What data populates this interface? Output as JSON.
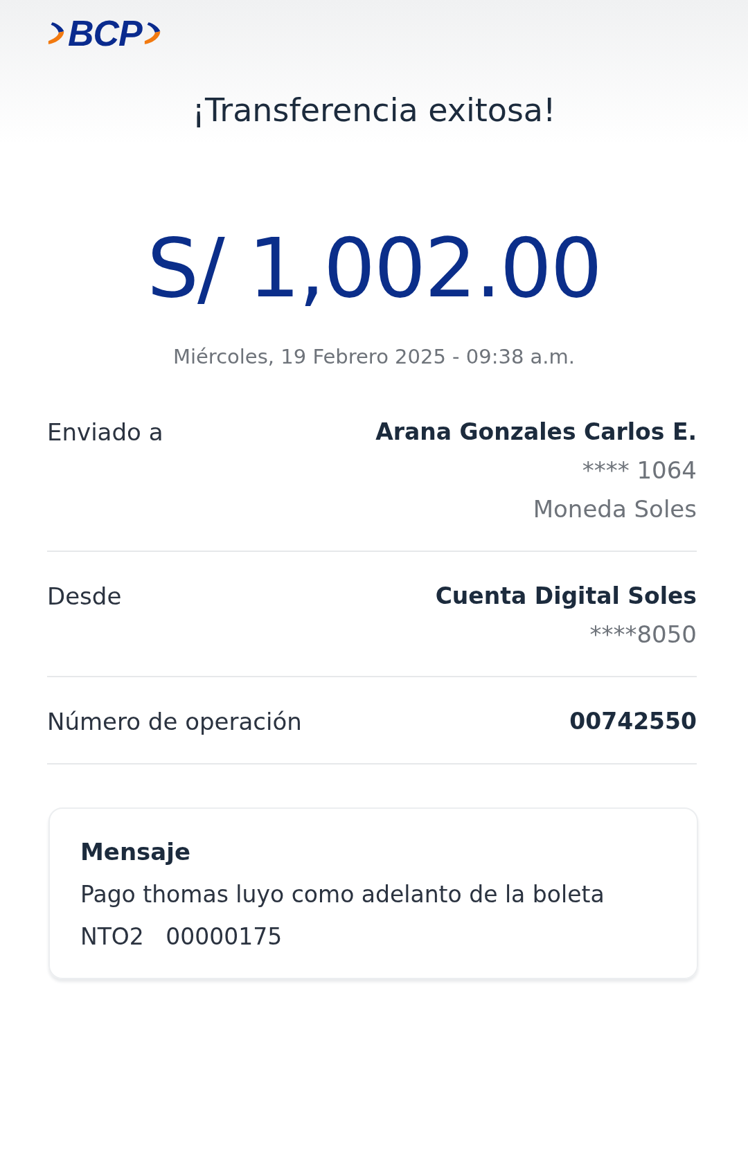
{
  "header": {
    "logo": "BCP"
  },
  "title": "¡Transferencia exitosa!",
  "amount": "S/ 1,002.00",
  "datetime": "Miércoles, 19 Febrero 2025 - 09:38 a.m.",
  "details": [
    {
      "label": "Enviado a",
      "values": [
        {
          "kind": "primary",
          "text": "Arana Gonzales Carlos E."
        },
        {
          "kind": "secondary",
          "text": "**** 1064"
        },
        {
          "kind": "secondary",
          "text": "Moneda Soles"
        }
      ]
    },
    {
      "label": "Desde",
      "values": [
        {
          "kind": "primary",
          "text": "Cuenta Digital Soles"
        },
        {
          "kind": "secondary",
          "text": "****8050"
        }
      ]
    },
    {
      "label": "Número de operación",
      "values": [
        {
          "kind": "primary",
          "text": "00742550"
        }
      ]
    }
  ],
  "message": {
    "title": "Mensaje",
    "lines": [
      "Pago thomas luyo como adelanto de la boleta",
      "NTO2   00000175"
    ]
  }
}
